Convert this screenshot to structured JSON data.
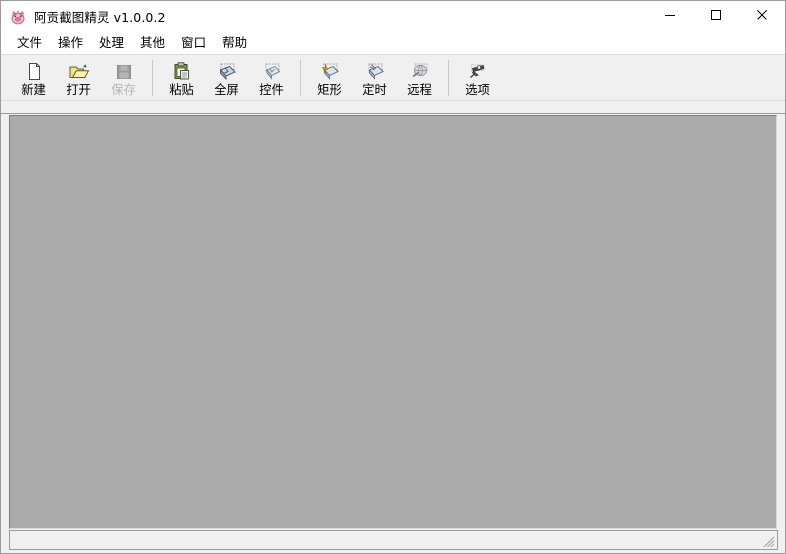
{
  "window": {
    "title": "阿贡截图精灵 v1.0.0.2",
    "app_icon": "pig-mascot-icon",
    "bg_color": "#ffffff",
    "border_color": "#9b9b9b"
  },
  "window_controls": [
    {
      "name": "minimize-button",
      "label": "—",
      "icon": "minimize-icon"
    },
    {
      "name": "maximize-button",
      "label": "□",
      "icon": "maximize-icon"
    },
    {
      "name": "close-button",
      "label": "✕",
      "icon": "close-icon"
    }
  ],
  "menu": {
    "items": [
      {
        "label": "文件",
        "name": "menu-file"
      },
      {
        "label": "操作",
        "name": "menu-operation"
      },
      {
        "label": "处理",
        "name": "menu-process"
      },
      {
        "label": "其他",
        "name": "menu-other"
      },
      {
        "label": "窗口",
        "name": "menu-window"
      },
      {
        "label": "帮助",
        "name": "menu-help"
      }
    ]
  },
  "toolbar": {
    "bg_color": "#f0f0f0",
    "groups": [
      {
        "buttons": [
          {
            "label": "新建",
            "icon": "new-document-icon",
            "name": "toolbar-new",
            "enabled": true
          },
          {
            "label": "打开",
            "icon": "open-folder-icon",
            "name": "toolbar-open",
            "enabled": true
          },
          {
            "label": "保存",
            "icon": "save-disk-icon",
            "name": "toolbar-save",
            "enabled": false
          }
        ]
      },
      {
        "buttons": [
          {
            "label": "粘贴",
            "icon": "paste-clipboard-icon",
            "name": "toolbar-paste",
            "enabled": true
          },
          {
            "label": "全屏",
            "icon": "fullscreen-capture-icon",
            "name": "toolbar-fullscreen",
            "enabled": true
          },
          {
            "label": "控件",
            "icon": "control-capture-icon",
            "name": "toolbar-control",
            "enabled": true
          }
        ]
      },
      {
        "buttons": [
          {
            "label": "矩形",
            "icon": "rectangle-capture-icon",
            "name": "toolbar-rectangle",
            "enabled": true
          },
          {
            "label": "定时",
            "icon": "timer-capture-icon",
            "name": "toolbar-timer",
            "enabled": true
          },
          {
            "label": "远程",
            "icon": "remote-capture-icon",
            "name": "toolbar-remote",
            "enabled": true
          }
        ]
      },
      {
        "buttons": [
          {
            "label": "选项",
            "icon": "options-icon",
            "name": "toolbar-options",
            "enabled": true
          }
        ]
      }
    ]
  },
  "canvas": {
    "bg_color": "#ababab",
    "content": ""
  },
  "status_bar": {
    "text": "",
    "resize_grip": "resize-grip-icon"
  }
}
